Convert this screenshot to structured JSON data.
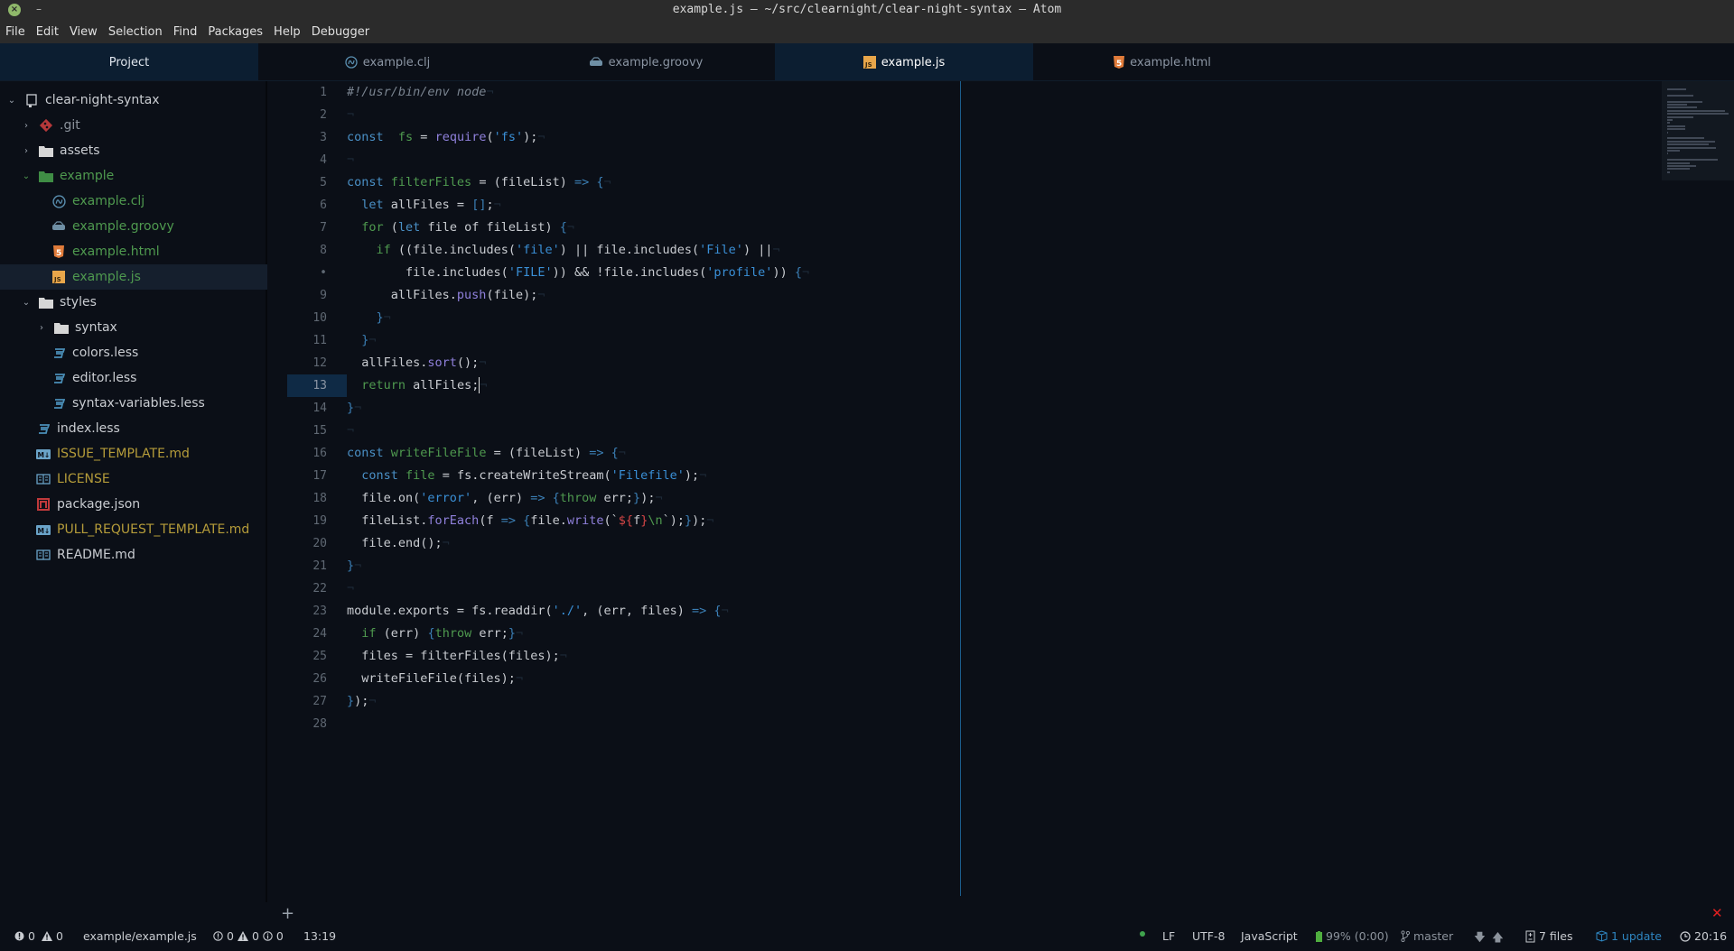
{
  "window": {
    "title": "example.js — ~/src/clearnight/clear-night-syntax — Atom",
    "close_glyph": "×",
    "minimize_glyph": "–"
  },
  "menu": [
    "File",
    "Edit",
    "View",
    "Selection",
    "Find",
    "Packages",
    "Help",
    "Debugger"
  ],
  "tabs": {
    "project": "Project",
    "files": [
      {
        "label": "example.clj",
        "icon": "clojure-icon",
        "active": false
      },
      {
        "label": "example.groovy",
        "icon": "groovy-icon",
        "active": false
      },
      {
        "label": "example.js",
        "icon": "javascript-icon",
        "active": true
      },
      {
        "label": "example.html",
        "icon": "html5-icon",
        "active": false
      }
    ]
  },
  "tree": [
    {
      "label": "clear-night-syntax",
      "depth": 0,
      "kind": "root",
      "expanded": true,
      "icon": "repo-icon"
    },
    {
      "label": ".git",
      "depth": 1,
      "kind": "dir",
      "expanded": false,
      "icon": "git-icon",
      "status": "muted"
    },
    {
      "label": "assets",
      "depth": 1,
      "kind": "dir",
      "expanded": false,
      "icon": "folder-icon"
    },
    {
      "label": "example",
      "depth": 1,
      "kind": "dir",
      "expanded": true,
      "icon": "folder-icon",
      "status": "added"
    },
    {
      "label": "example.clj",
      "depth": 2,
      "kind": "file",
      "icon": "clojure-icon",
      "status": "added"
    },
    {
      "label": "example.groovy",
      "depth": 2,
      "kind": "file",
      "icon": "groovy-icon",
      "status": "added"
    },
    {
      "label": "example.html",
      "depth": 2,
      "kind": "file",
      "icon": "html5-icon",
      "status": "added"
    },
    {
      "label": "example.js",
      "depth": 2,
      "kind": "file",
      "icon": "javascript-icon",
      "status": "added",
      "selected": true
    },
    {
      "label": "styles",
      "depth": 1,
      "kind": "dir",
      "expanded": true,
      "icon": "folder-icon"
    },
    {
      "label": "syntax",
      "depth": 2,
      "kind": "dir",
      "expanded": false,
      "icon": "folder-icon"
    },
    {
      "label": "colors.less",
      "depth": 2,
      "kind": "file",
      "icon": "css3-icon"
    },
    {
      "label": "editor.less",
      "depth": 2,
      "kind": "file",
      "icon": "css3-icon"
    },
    {
      "label": "syntax-variables.less",
      "depth": 2,
      "kind": "file",
      "icon": "css3-icon"
    },
    {
      "label": "index.less",
      "depth": 1,
      "kind": "file",
      "icon": "css3-icon"
    },
    {
      "label": "ISSUE_TEMPLATE.md",
      "depth": 1,
      "kind": "file",
      "icon": "markdown-icon",
      "status": "modified"
    },
    {
      "label": "LICENSE",
      "depth": 1,
      "kind": "file",
      "icon": "book-icon",
      "status": "modified"
    },
    {
      "label": "package.json",
      "depth": 1,
      "kind": "file",
      "icon": "npm-icon"
    },
    {
      "label": "PULL_REQUEST_TEMPLATE.md",
      "depth": 1,
      "kind": "file",
      "icon": "markdown-icon",
      "status": "modified"
    },
    {
      "label": "README.md",
      "depth": 1,
      "kind": "file",
      "icon": "book-icon"
    }
  ],
  "editor": {
    "cursor_line": 13,
    "gutter": [
      "1",
      "2",
      "3",
      "4",
      "5",
      "6",
      "7",
      "8",
      "•",
      "9",
      "10",
      "11",
      "12",
      "13",
      "14",
      "15",
      "16",
      "17",
      "18",
      "19",
      "20",
      "21",
      "22",
      "23",
      "24",
      "25",
      "26",
      "27",
      "28"
    ],
    "lines": [
      [
        [
          "cmt",
          "#!/usr/bin/env node"
        ]
      ],
      [],
      [
        [
          "kw",
          "const"
        ],
        [
          "",
          "  "
        ],
        [
          "def",
          "fs"
        ],
        [
          "",
          " = "
        ],
        [
          "fn",
          "require"
        ],
        [
          "",
          "("
        ],
        [
          "str",
          "'fs'"
        ],
        [
          "",
          ");"
        ]
      ],
      [],
      [
        [
          "kw",
          "const"
        ],
        [
          "",
          " "
        ],
        [
          "def",
          "filterFiles"
        ],
        [
          "",
          " = (fileList) "
        ],
        [
          "punc",
          "=>"
        ],
        [
          "",
          " "
        ],
        [
          "punc",
          "{"
        ]
      ],
      [
        [
          "",
          "  "
        ],
        [
          "kw",
          "let"
        ],
        [
          "",
          " allFiles = "
        ],
        [
          "punc",
          "[]"
        ],
        [
          "",
          ";"
        ]
      ],
      [
        [
          "",
          "  "
        ],
        [
          "ctl",
          "for"
        ],
        [
          "",
          " ("
        ],
        [
          "kw",
          "let"
        ],
        [
          "",
          " file of fileList) "
        ],
        [
          "punc",
          "{"
        ]
      ],
      [
        [
          "",
          "    "
        ],
        [
          "ctl",
          "if"
        ],
        [
          "",
          " ((file.includes("
        ],
        [
          "str",
          "'file'"
        ],
        [
          "",
          ") || file.includes("
        ],
        [
          "str",
          "'File'"
        ],
        [
          "",
          ") ||"
        ]
      ],
      [
        [
          "",
          "        file.includes("
        ],
        [
          "str",
          "'FILE'"
        ],
        [
          "",
          ")) && !file.includes("
        ],
        [
          "str",
          "'profile'"
        ],
        [
          "",
          ")) "
        ],
        [
          "punc",
          "{"
        ]
      ],
      [
        [
          "",
          "      allFiles."
        ],
        [
          "fn",
          "push"
        ],
        [
          "",
          "(file);"
        ]
      ],
      [
        [
          "",
          "    "
        ],
        [
          "punc",
          "}"
        ]
      ],
      [
        [
          "",
          "  "
        ],
        [
          "punc",
          "}"
        ]
      ],
      [
        [
          "",
          "  allFiles."
        ],
        [
          "fn",
          "sort"
        ],
        [
          "",
          "();"
        ]
      ],
      [
        [
          "",
          "  "
        ],
        [
          "ctl",
          "return"
        ],
        [
          "",
          " allFiles;"
        ]
      ],
      [
        [
          "punc",
          "}"
        ]
      ],
      [],
      [
        [
          "kw",
          "const"
        ],
        [
          "",
          " "
        ],
        [
          "def",
          "writeFileFile"
        ],
        [
          "",
          " = (fileList) "
        ],
        [
          "punc",
          "=>"
        ],
        [
          "",
          " "
        ],
        [
          "punc",
          "{"
        ]
      ],
      [
        [
          "",
          "  "
        ],
        [
          "kw",
          "const"
        ],
        [
          "",
          " "
        ],
        [
          "def",
          "file"
        ],
        [
          "",
          " = fs.createWriteStream("
        ],
        [
          "str",
          "'Filefile'"
        ],
        [
          "",
          ");"
        ]
      ],
      [
        [
          "",
          "  file.on("
        ],
        [
          "str",
          "'error'"
        ],
        [
          "",
          ", (err) "
        ],
        [
          "punc",
          "=>"
        ],
        [
          "",
          " "
        ],
        [
          "punc",
          "{"
        ],
        [
          "ctl",
          "throw"
        ],
        [
          "",
          " err;"
        ],
        [
          "punc",
          "}"
        ],
        [
          "",
          ");"
        ]
      ],
      [
        [
          "",
          "  fileList."
        ],
        [
          "fn",
          "forEach"
        ],
        [
          "",
          "(f "
        ],
        [
          "punc",
          "=>"
        ],
        [
          "",
          " "
        ],
        [
          "punc",
          "{"
        ],
        [
          "",
          "file."
        ],
        [
          "fn",
          "write"
        ],
        [
          "",
          "(`"
        ],
        [
          "tpl",
          "${"
        ],
        [
          "",
          "f"
        ],
        [
          "tpl",
          "}"
        ],
        [
          "esc",
          "\\n"
        ],
        [
          "",
          "`);"
        ],
        [
          "punc",
          "}"
        ],
        [
          "",
          ");"
        ]
      ],
      [
        [
          "",
          "  file.end();"
        ]
      ],
      [
        [
          "punc",
          "}"
        ]
      ],
      [],
      [
        [
          "",
          "module.exports = fs.readdir("
        ],
        [
          "str",
          "'./'"
        ],
        [
          "",
          ", (err, files) "
        ],
        [
          "punc",
          "=>"
        ],
        [
          "",
          " "
        ],
        [
          "punc",
          "{"
        ]
      ],
      [
        [
          "",
          "  "
        ],
        [
          "ctl",
          "if"
        ],
        [
          "",
          " (err) "
        ],
        [
          "punc",
          "{"
        ],
        [
          "ctl",
          "throw"
        ],
        [
          "",
          " err;"
        ],
        [
          "punc",
          "}"
        ]
      ],
      [
        [
          "",
          "  files = filterFiles(files);"
        ]
      ],
      [
        [
          "",
          "  writeFileFile(files);"
        ]
      ],
      [
        [
          "punc",
          "}"
        ],
        [
          "",
          ");"
        ]
      ],
      []
    ]
  },
  "footer": {
    "add_glyph": "+",
    "error_glyph": "✕"
  },
  "status": {
    "errors": "0",
    "warnings": "0",
    "path": "example/example.js",
    "lint_errors": "0",
    "lint_warnings": "0",
    "lint_info": "0",
    "cursor": "13:19",
    "line_ending": "LF",
    "encoding": "UTF-8",
    "grammar": "JavaScript",
    "battery": "99% (0:00)",
    "branch": "master",
    "changed_files": "7 files",
    "updates": "1 update",
    "clock": "20:16"
  },
  "colors": {
    "accent": "#2e85c0",
    "added": "#4f9a4f",
    "modified": "#b59c3a",
    "error": "#e02020"
  }
}
